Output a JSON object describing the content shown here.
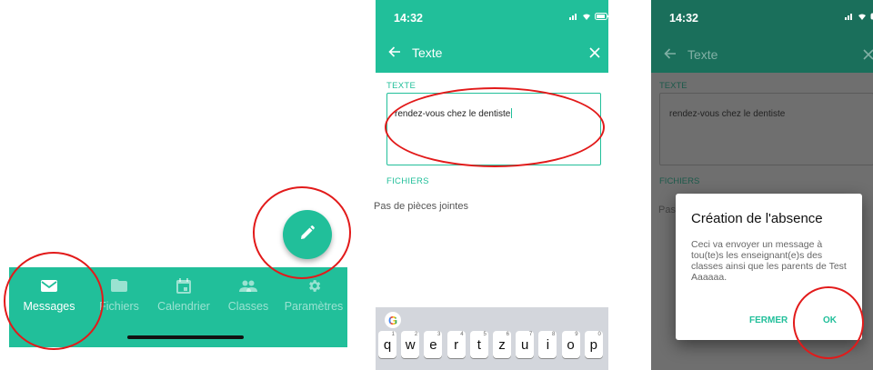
{
  "panel1": {
    "tabs": [
      {
        "label": "Messages",
        "icon": "envelope-icon",
        "active": true
      },
      {
        "label": "Fichiers",
        "icon": "folder-icon",
        "active": false
      },
      {
        "label": "Calendrier",
        "icon": "calendar-icon",
        "active": false
      },
      {
        "label": "Classes",
        "icon": "people-icon",
        "active": false
      },
      {
        "label": "Paramètres",
        "icon": "gear-icon",
        "active": false
      }
    ],
    "fab_icon": "pencil-icon"
  },
  "panel2": {
    "status_time": "14:32",
    "header_title": "Texte",
    "texte_label": "TEXTE",
    "text_value": "rendez-vous chez le dentiste",
    "fichiers_label": "FICHIERS",
    "no_attachments": "Pas de pièces jointes",
    "keyboard": {
      "row1": [
        {
          "k": "q",
          "n": "1"
        },
        {
          "k": "w",
          "n": "2"
        },
        {
          "k": "e",
          "n": "3"
        },
        {
          "k": "r",
          "n": "4"
        },
        {
          "k": "t",
          "n": "5"
        },
        {
          "k": "z",
          "n": "6"
        },
        {
          "k": "u",
          "n": "7"
        },
        {
          "k": "i",
          "n": "8"
        },
        {
          "k": "o",
          "n": "9"
        },
        {
          "k": "p",
          "n": "0"
        }
      ]
    }
  },
  "panel3": {
    "status_time": "14:32",
    "header_title": "Texte",
    "texte_label": "TEXTE",
    "text_value": "rendez-vous chez le dentiste",
    "fichiers_label": "FICHIERS",
    "behind_text": "Pas",
    "dialog": {
      "title": "Création de l'absence",
      "body": "Ceci va envoyer un message à tou(te)s les enseignant(e)s des classes ainsi que les parents de Test Aaaaaa.",
      "cancel": "FERMER",
      "ok": "OK"
    }
  },
  "colors": {
    "accent": "#21bf9a",
    "dark_header": "#1a6f5b",
    "highlight": "#e21a1a"
  }
}
